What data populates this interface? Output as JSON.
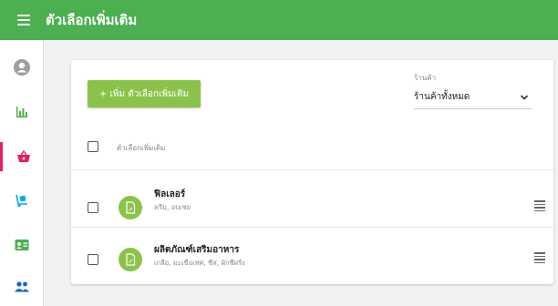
{
  "header": {
    "title": "ตัวเลือกเพิ่มเติม"
  },
  "sidebar": {
    "items": [
      {
        "icon": "user-circle-icon",
        "color": "#9e9e9e"
      },
      {
        "icon": "bar-chart-icon",
        "color": "#4caf50"
      },
      {
        "icon": "shopping-basket-icon",
        "color": "#e91e63",
        "active": true
      },
      {
        "icon": "hand-truck-icon",
        "color": "#03a9f4"
      },
      {
        "icon": "id-card-icon",
        "color": "#4caf50"
      },
      {
        "icon": "users-icon",
        "color": "#1565c0"
      }
    ]
  },
  "toolbar": {
    "add_label": "+ เพิ่ม ตัวเลือกเพิ่มเติม"
  },
  "store": {
    "label": "ร้านค้า",
    "value": "ร้านค้าทั้งหมด"
  },
  "list": {
    "column_header": "ตัวเลือกเพิ่มเติม",
    "items": [
      {
        "title": "ฟิลเลอร์",
        "subtitle": "ครีม, อบเชย"
      },
      {
        "title": "ผลิตภัณฑ์เสริมอาหาร",
        "subtitle": "เกลือ, มะเขือเทศ, ชีส, ผักชีฝรั่ง"
      }
    ]
  },
  "colors": {
    "header": "#4caf50",
    "accent": "#8bc34a",
    "active": "#e91e63"
  }
}
